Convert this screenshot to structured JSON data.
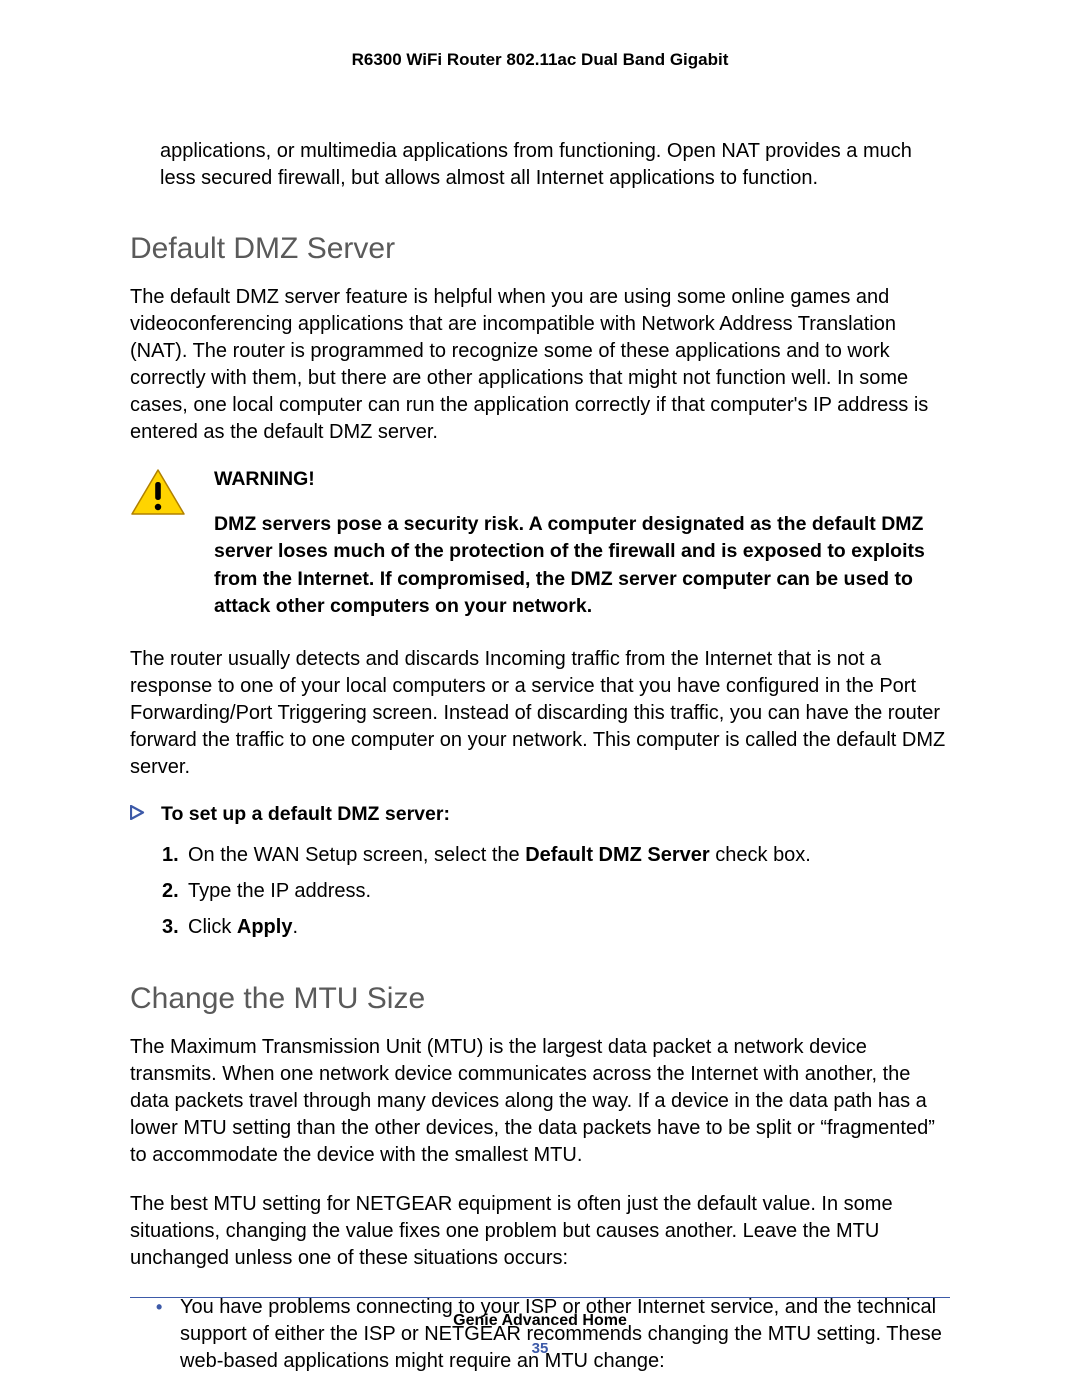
{
  "header": {
    "title": "R6300 WiFi Router 802.11ac Dual Band Gigabit"
  },
  "intro_continuation": "applications, or multimedia applications from functioning. Open NAT provides a much less secured firewall, but allows almost all Internet applications to function.",
  "section1": {
    "heading": "Default DMZ Server",
    "para1": "The default DMZ server feature is helpful when you are using some online games and videoconferencing applications that are incompatible with Network Address Translation (NAT). The router is programmed to recognize some of these applications and to work correctly with them, but there are other applications that might not function well. In some cases, one local computer can run the application correctly if that computer's IP address is entered as the default DMZ server.",
    "warning": {
      "title": "WARNING!",
      "body": "DMZ servers pose a security risk. A computer designated as the default DMZ server loses much of the protection of the firewall and is exposed to exploits from the Internet. If compromised, the DMZ server computer can be used to attack other computers on your network."
    },
    "para2": "The router usually detects and discards Incoming traffic from the Internet that is not a response to one of your local computers or a service that you have configured in the Port Forwarding/Port Triggering screen. Instead of discarding this traffic, you can have the router forward the traffic to one computer on your network. This computer is called the default DMZ server.",
    "task_title": "To set up a default DMZ server:",
    "steps": {
      "s1_pre": "On the WAN Setup screen, select the ",
      "s1_bold": "Default DMZ Server",
      "s1_post": " check box.",
      "s2": "Type the IP address.",
      "s3_pre": "Click ",
      "s3_bold": "Apply",
      "s3_post": "."
    }
  },
  "section2": {
    "heading": "Change the MTU Size",
    "para1": "The Maximum Transmission Unit (MTU) is the largest data packet a network device transmits. When one network device communicates across the Internet with another, the data packets travel through many devices along the way. If a device in the data path has a lower MTU setting than the other devices, the data packets have to be split or “fragmented” to accommodate the device with the smallest MTU.",
    "para2": "The best MTU setting for NETGEAR equipment is often just the default value. In some situations, changing the value fixes one problem but causes another. Leave the MTU unchanged unless one of these situations occurs:",
    "bullet1": "You have problems connecting to your ISP or other Internet service, and the technical support of either the ISP or NETGEAR recommends changing the MTU setting. These web-based applications might require an MTU change:"
  },
  "footer": {
    "section_name": "Genie Advanced Home",
    "page_number": "35"
  }
}
